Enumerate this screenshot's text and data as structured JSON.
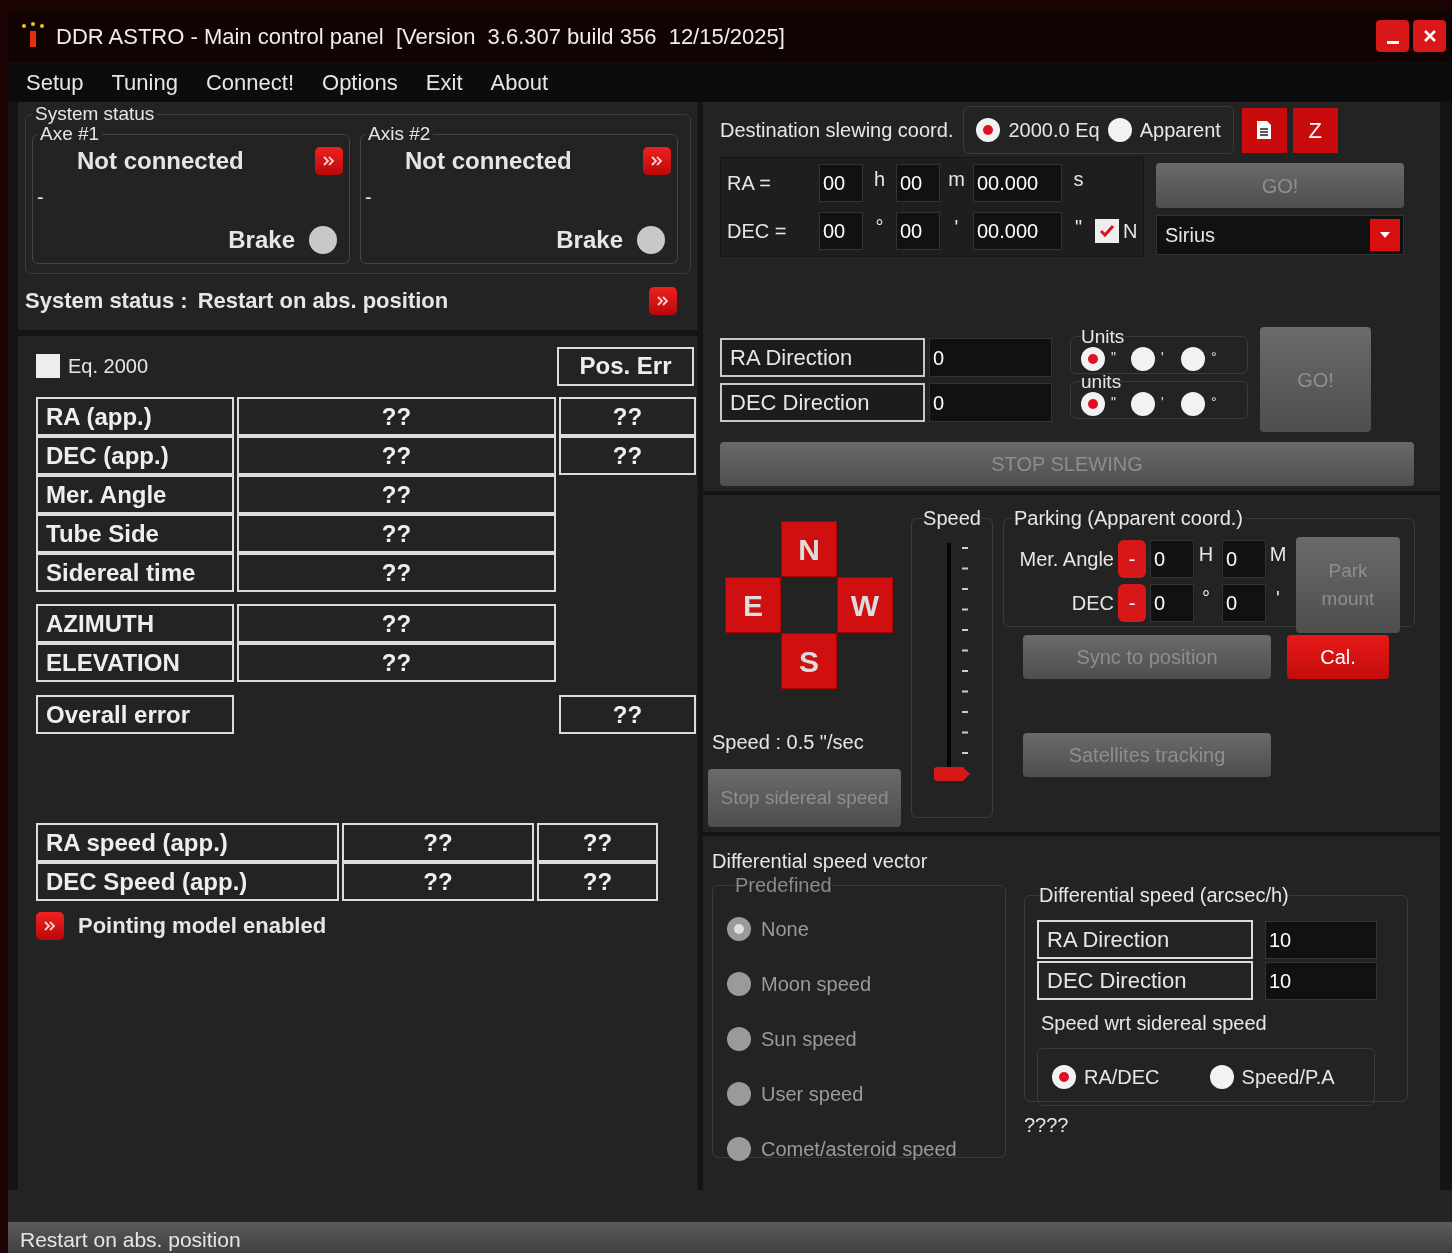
{
  "window": {
    "title": "DDR ASTRO - Main control panel  [Version  3.6.307 build 356  12/15/2025]"
  },
  "menu": [
    "Setup",
    "Tuning",
    "Connect!",
    "Options",
    "Exit",
    "About"
  ],
  "system_status": {
    "title": "System status",
    "axes": [
      {
        "label": "Axe #1",
        "state": "Not connected",
        "detail": "-",
        "brake": "Brake"
      },
      {
        "label": "Axis #2",
        "state": "Not connected",
        "detail": "-",
        "brake": "Brake"
      }
    ],
    "status_label": "System status :",
    "status_value": "Restart on abs. position"
  },
  "position": {
    "eq2000": {
      "label": "Eq. 2000",
      "checked": false
    },
    "error_header": "Pos. Err",
    "rows": [
      {
        "label": "RA (app.)",
        "value": "??",
        "error": "??"
      },
      {
        "label": "DEC (app.)",
        "value": "??",
        "error": "??"
      },
      {
        "label": "Mer. Angle",
        "value": "??"
      },
      {
        "label": "Tube Side",
        "value": "??"
      },
      {
        "label": "Sidereal time",
        "value": "??"
      }
    ],
    "altaz_rows": [
      {
        "label": "AZIMUTH",
        "value": "??"
      },
      {
        "label": "ELEVATION",
        "value": "??"
      }
    ],
    "overall": {
      "label": "Overall error",
      "error": "??"
    }
  },
  "speeds": [
    {
      "label": "RA speed (app.)",
      "value": "??",
      "error": "??"
    },
    {
      "label": "DEC Speed (app.)",
      "value": "??",
      "error": "??"
    }
  ],
  "pointing_model": "Pointing model enabled",
  "destination": {
    "title": "Destination slewing coord.",
    "frames": [
      {
        "label": "2000.0 Eq",
        "selected": true
      },
      {
        "label": "Apparent",
        "selected": false
      }
    ],
    "z_button": "Z",
    "ra": {
      "label": "RA =",
      "fields": [
        {
          "value": "00",
          "unit": "h"
        },
        {
          "value": "00",
          "unit": "m"
        },
        {
          "value": "00.000",
          "unit": "s"
        }
      ]
    },
    "dec": {
      "label": "DEC =",
      "fields": [
        {
          "value": "00",
          "unit": "°"
        },
        {
          "value": "00",
          "unit": "'"
        },
        {
          "value": "00.000",
          "unit": "\""
        }
      ]
    },
    "north": {
      "label": "N",
      "checked": true
    },
    "go": {
      "label": "GO!",
      "disabled": true
    },
    "target": "Sirius"
  },
  "offsets": {
    "rows": [
      {
        "label": "RA Direction",
        "value": "0",
        "units_title": "Units",
        "units": [
          {
            "label": "\"",
            "selected": true
          },
          {
            "label": "'",
            "selected": false
          },
          {
            "label": "°",
            "selected": false
          }
        ]
      },
      {
        "label": "DEC Direction",
        "value": "0",
        "units_title": "units",
        "units": [
          {
            "label": "\"",
            "selected": true
          },
          {
            "label": "'",
            "selected": false
          },
          {
            "label": "°",
            "selected": false
          }
        ]
      }
    ],
    "go": {
      "label": "GO!",
      "disabled": true
    },
    "stop": {
      "label": "STOP SLEWING",
      "disabled": true
    }
  },
  "pad": {
    "north": "N",
    "east": "E",
    "west": "W",
    "south": "S",
    "speed_text": "Speed : 0.5 \"/sec",
    "stop_sidereal": {
      "label": "Stop sidereal speed",
      "disabled": true
    }
  },
  "speed_slider": {
    "title": "Speed",
    "level": 0
  },
  "parking": {
    "title": "Parking (Apparent coord.)",
    "rows": [
      {
        "label": "Mer. Angle",
        "sign": "-",
        "fields": [
          {
            "value": "0",
            "unit": "H"
          },
          {
            "value": "0",
            "unit": "M"
          }
        ]
      },
      {
        "label": "DEC",
        "sign": "-",
        "fields": [
          {
            "value": "0",
            "unit": "°"
          },
          {
            "value": "0",
            "unit": "'"
          }
        ]
      }
    ],
    "park": {
      "label": "Park mount",
      "disabled": true
    }
  },
  "sync": {
    "label": "Sync to position",
    "disabled": true
  },
  "cal": {
    "label": "Cal.",
    "disabled": false
  },
  "satellites": {
    "label": "Satellites tracking",
    "disabled": true
  },
  "differential": {
    "title": "Differential speed vector",
    "predefined_title": "Predefined",
    "predefined_disabled": true,
    "options": [
      {
        "label": "None",
        "selected": true
      },
      {
        "label": "Moon speed",
        "selected": false
      },
      {
        "label": "Sun speed",
        "selected": false
      },
      {
        "label": "User speed",
        "selected": false
      },
      {
        "label": "Comet/asteroid speed",
        "selected": false
      }
    ],
    "rates_title": "Differential speed (arcsec/h)",
    "rates": [
      {
        "label": "RA Direction",
        "value": "10"
      },
      {
        "label": "DEC Direction",
        "value": "10"
      }
    ],
    "mode_title": "Speed wrt sidereal speed",
    "modes": [
      {
        "label": "RA/DEC",
        "selected": true
      },
      {
        "label": "Speed/P.A",
        "selected": false
      }
    ],
    "result": "????"
  },
  "status_bar": {
    "text": "Restart on abs. position"
  }
}
